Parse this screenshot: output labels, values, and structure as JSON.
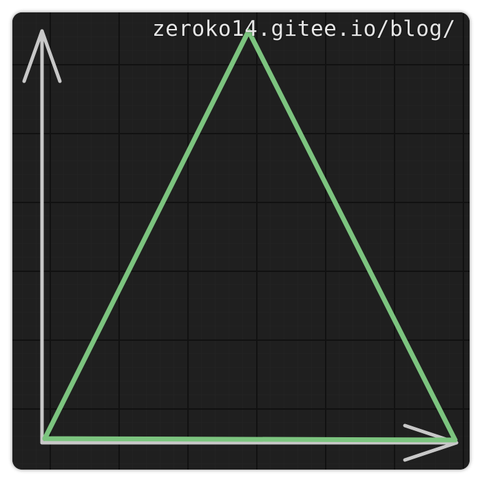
{
  "watermark": "zeroko14.gitee.io/blog/",
  "colors": {
    "background": "#1f1f1f",
    "grid_major": "#121212",
    "grid_minor": "#262626",
    "axis": "#c8c8c8",
    "triangle": "#7cc47f"
  },
  "diagram": {
    "shape": "triangle",
    "axes": [
      "x-axis-arrow",
      "y-axis-arrow"
    ]
  }
}
